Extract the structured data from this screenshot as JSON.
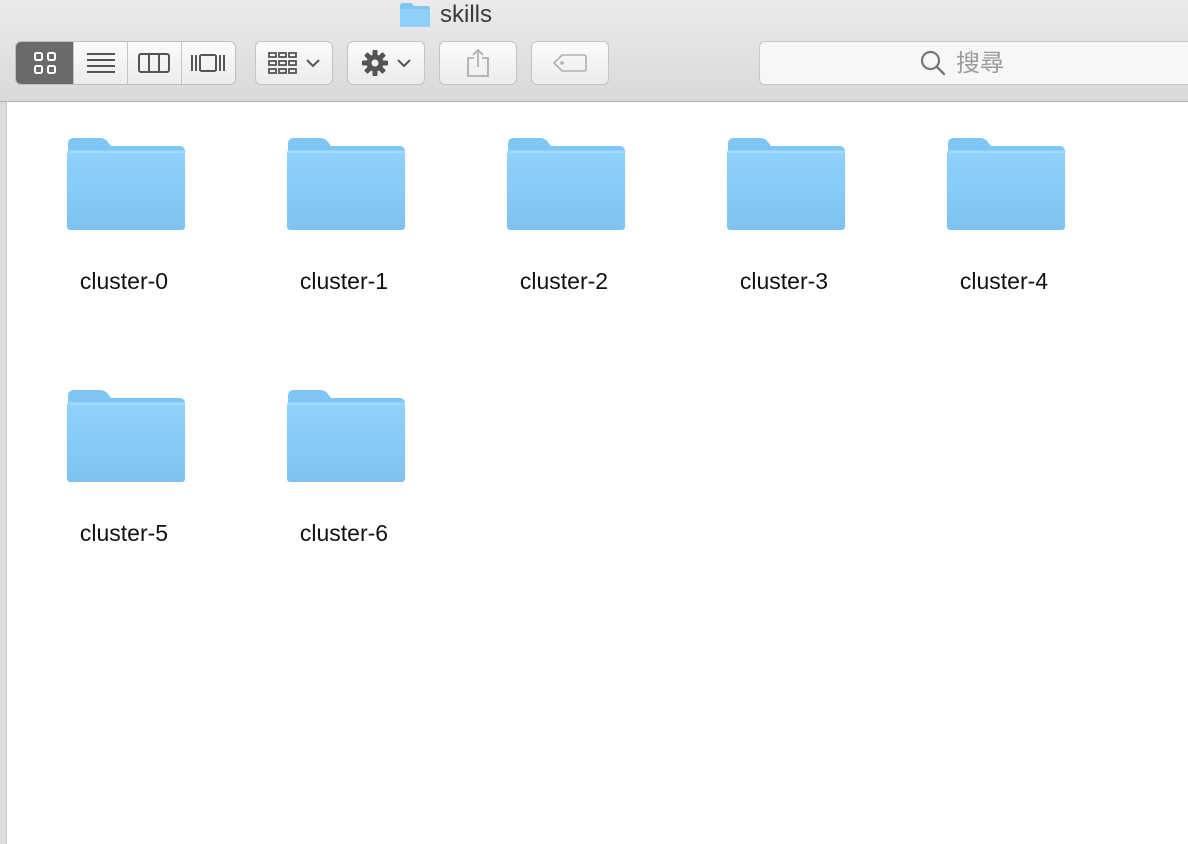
{
  "window": {
    "title": "skills"
  },
  "toolbar": {
    "view_modes": [
      "icon-view",
      "list-view",
      "column-view",
      "cover-flow-view"
    ],
    "active_view": "icon-view",
    "arrange_icon": "arrange-icon",
    "action_icon": "gear-icon",
    "share_icon": "share-icon",
    "tags_icon": "tag-icon"
  },
  "search": {
    "placeholder": "搜尋"
  },
  "folder_color": "#8ecdf8",
  "files": [
    {
      "name": "cluster-0"
    },
    {
      "name": "cluster-1"
    },
    {
      "name": "cluster-2"
    },
    {
      "name": "cluster-3"
    },
    {
      "name": "cluster-4"
    },
    {
      "name": "cluster-5"
    },
    {
      "name": "cluster-6"
    }
  ]
}
